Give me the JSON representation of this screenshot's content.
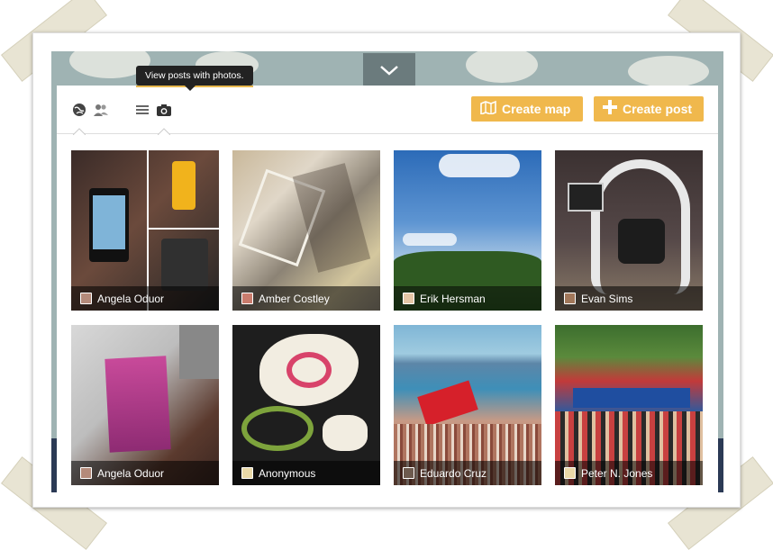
{
  "toolbar": {
    "tooltip": "View posts with photos.",
    "create_map_label": "Create map",
    "create_post_label": "Create post",
    "icons": [
      "globe-icon",
      "users-icon",
      "list-icon",
      "camera-icon"
    ],
    "accent_color": "#f0b84c"
  },
  "posts": [
    {
      "author": "Angela Oduor",
      "image": "phones-collage"
    },
    {
      "author": "Amber Costley",
      "image": "abstract-architecture"
    },
    {
      "author": "Erik Hersman",
      "image": "sky-trees"
    },
    {
      "author": "Evan Sims",
      "image": "futuristic-chair"
    },
    {
      "author": "Angela Oduor",
      "image": "perfume-box"
    },
    {
      "author": "Anonymous",
      "image": "patterned-fabric"
    },
    {
      "author": "Eduardo Cruz",
      "image": "beach-crowd-flag"
    },
    {
      "author": "Peter N. Jones",
      "image": "protest-crowd"
    }
  ]
}
